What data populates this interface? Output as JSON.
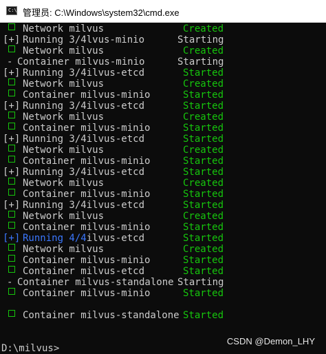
{
  "window": {
    "title": "管理员: C:\\Windows\\system32\\cmd.exe",
    "icon": "cmd-icon",
    "icon_text": "C:\\"
  },
  "colors": {
    "background": "#0c0c0c",
    "text": "#cccccc",
    "green": "#16c60c",
    "blue": "#3b78ff"
  },
  "console": {
    "lines": [
      {
        "prefix": "box",
        "label": "Network milvus",
        "status": "Created",
        "status_color": "green"
      },
      {
        "prefix": "[+]",
        "label": "Running 3/4lvus-minio",
        "status": "Starting",
        "status_color": "white"
      },
      {
        "prefix": "box",
        "label": "Network milvus",
        "status": "Created",
        "status_color": "green"
      },
      {
        "prefix": "-",
        "label": "Container milvus-minio",
        "status": "Starting",
        "status_color": "white"
      },
      {
        "prefix": "[+]",
        "label": "Running 3/4ilvus-etcd",
        "status": "Started",
        "status_color": "green"
      },
      {
        "prefix": "box",
        "label": "Network milvus",
        "status": "Created",
        "status_color": "green"
      },
      {
        "prefix": "box",
        "label": "Container milvus-minio",
        "status": "Started",
        "status_color": "green"
      },
      {
        "prefix": "[+]",
        "label": "Running 3/4ilvus-etcd",
        "status": "Started",
        "status_color": "green"
      },
      {
        "prefix": "box",
        "label": "Network milvus",
        "status": "Created",
        "status_color": "green"
      },
      {
        "prefix": "box",
        "label": "Container milvus-minio",
        "status": "Started",
        "status_color": "green"
      },
      {
        "prefix": "[+]",
        "label": "Running 3/4ilvus-etcd",
        "status": "Started",
        "status_color": "green"
      },
      {
        "prefix": "box",
        "label": "Network milvus",
        "status": "Created",
        "status_color": "green"
      },
      {
        "prefix": "box",
        "label": "Container milvus-minio",
        "status": "Started",
        "status_color": "green"
      },
      {
        "prefix": "[+]",
        "label": "Running 3/4ilvus-etcd",
        "status": "Started",
        "status_color": "green"
      },
      {
        "prefix": "box",
        "label": "Network milvus",
        "status": "Created",
        "status_color": "green"
      },
      {
        "prefix": "box",
        "label": "Container milvus-minio",
        "status": "Started",
        "status_color": "green"
      },
      {
        "prefix": "[+]",
        "label": "Running 3/4ilvus-etcd",
        "status": "Started",
        "status_color": "green"
      },
      {
        "prefix": "box",
        "label": "Network milvus",
        "status": "Created",
        "status_color": "green"
      },
      {
        "prefix": "box",
        "label": "Container milvus-minio",
        "status": "Started",
        "status_color": "green"
      },
      {
        "prefix": "[+]",
        "label_blue": "Running 4/4",
        "label": "ilvus-etcd",
        "status": "Started",
        "status_color": "green",
        "blue": true
      },
      {
        "prefix": "box",
        "label": "Network milvus",
        "status": "Created",
        "status_color": "green"
      },
      {
        "prefix": "box",
        "label": "Container milvus-minio",
        "status": "Started",
        "status_color": "green"
      },
      {
        "prefix": "box",
        "label": "Container milvus-etcd",
        "status": "Started",
        "status_color": "green"
      },
      {
        "prefix": "-",
        "label": "Container milvus-standalone",
        "status": "Starting",
        "status_color": "white"
      },
      {
        "prefix": "box",
        "label": "Container milvus-minio",
        "status": "Started",
        "status_color": "green"
      },
      {
        "prefix": "blank"
      },
      {
        "prefix": "box",
        "label": "Container milvus-standalone",
        "status": "Started",
        "status_color": "green"
      },
      {
        "prefix": "blank"
      },
      {
        "prefix": "blank"
      },
      {
        "prefix": "prompt",
        "text": "D:\\milvus>"
      }
    ]
  },
  "watermark": "CSDN @Demon_LHY"
}
